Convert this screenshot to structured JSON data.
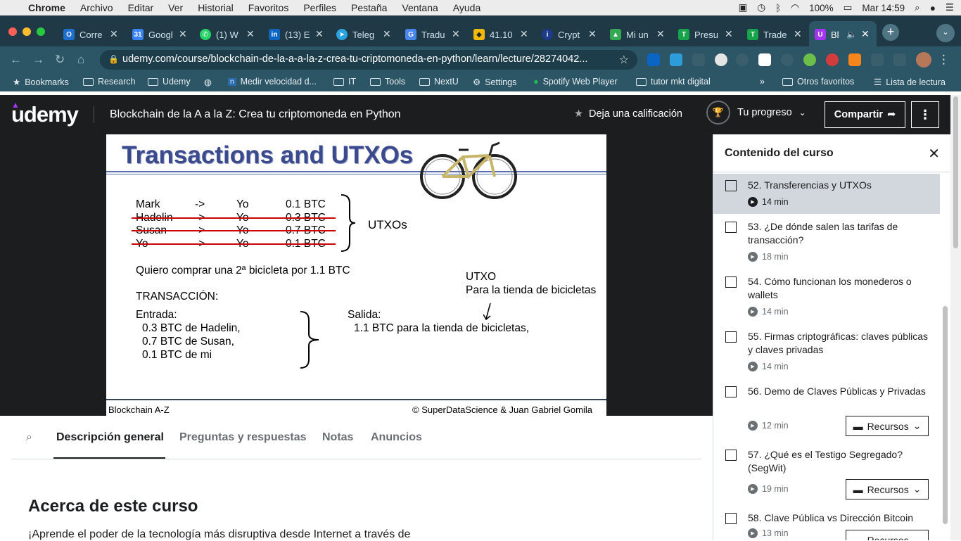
{
  "menubar": {
    "app": "Chrome",
    "items": [
      "Archivo",
      "Editar",
      "Ver",
      "Historial",
      "Favoritos",
      "Perfiles",
      "Pestaña",
      "Ventana",
      "Ayuda"
    ],
    "battery": "100%",
    "clock": "Mar 14:59"
  },
  "tabs": [
    {
      "label": "Corre"
    },
    {
      "label": "Googl"
    },
    {
      "label": "(1) W"
    },
    {
      "label": "(13) E"
    },
    {
      "label": "Teleg"
    },
    {
      "label": "Tradu"
    },
    {
      "label": "41.10"
    },
    {
      "label": "Crypt"
    },
    {
      "label": "Mi un"
    },
    {
      "label": "Presu"
    },
    {
      "label": "Trade"
    },
    {
      "label": "Bl"
    }
  ],
  "address": {
    "url": "udemy.com/course/blockchain-de-la-a-a-la-z-crea-tu-criptomoneda-en-python/learn/lecture/28274042..."
  },
  "bookmarks": [
    "Bookmarks",
    "Research",
    "Udemy",
    "Medir velocidad d...",
    "IT",
    "Tools",
    "NextU",
    "Settings",
    "Spotify Web Player",
    "tutor mkt digital",
    "Otros favoritos",
    "Lista de lectura"
  ],
  "header": {
    "course_title": "Blockchain de la A a la Z: Crea tu criptomoneda en Python",
    "rate": "Deja una calificación",
    "progress": "Tu progreso",
    "share": "Compartir"
  },
  "slide": {
    "title": "Transactions and UTXOs",
    "rows": [
      [
        "Mark",
        "->",
        "Yo",
        "0.1 BTC"
      ],
      [
        "Hadelin",
        "->",
        "Yo",
        "0.3 BTC"
      ],
      [
        "Susan",
        "->",
        "Yo",
        "0.7 BTC"
      ],
      [
        "Yo",
        "->",
        "Yo",
        "0.1 BTC"
      ]
    ],
    "utxos": "UTXOs",
    "want": "Quiero comprar una 2ª bicicleta por 1.1 BTC",
    "utxo_label": "UTXO",
    "utxo_sub": "Para la tienda de bicicletas",
    "tx": "TRANSACCIÓN:",
    "in_label": "Entrada:",
    "inputs": [
      "0.3 BTC de Hadelin,",
      "0.7 BTC de Susan,",
      "0.1 BTC de mi"
    ],
    "out_label": "Salida:",
    "output": "1.1 BTC para la tienda de bicicletas,",
    "foot_left": "Blockchain A-Z",
    "foot_right": "© SuperDataScience & Juan Gabriel Gomila"
  },
  "sidebar": {
    "title": "Contenido del curso",
    "resources": "Recursos",
    "lectures": [
      {
        "name": "52. Transferencias y UTXOs",
        "dur": "14 min"
      },
      {
        "name": "53. ¿De dónde salen las tarifas de transacción?",
        "dur": "18 min"
      },
      {
        "name": "54. Cómo funcionan los monederos o wallets",
        "dur": "14 min"
      },
      {
        "name": "55. Firmas criptográficas: claves públicas y claves privadas",
        "dur": "14 min"
      },
      {
        "name": "56. Demo de Claves Públicas y Privadas",
        "dur": "12 min"
      },
      {
        "name": "57. ¿Qué es el Testigo Segregado? (SegWit)",
        "dur": "19 min"
      },
      {
        "name": "58. Clave Pública vs Dirección Bitcoin",
        "dur": "13 min"
      }
    ]
  },
  "content_tabs": [
    "Descripción general",
    "Preguntas y respuestas",
    "Notas",
    "Anuncios"
  ],
  "about": {
    "title": "Acerca de este curso",
    "text": "¡Aprende el poder de la tecnología más disruptiva desde Internet a través de"
  }
}
